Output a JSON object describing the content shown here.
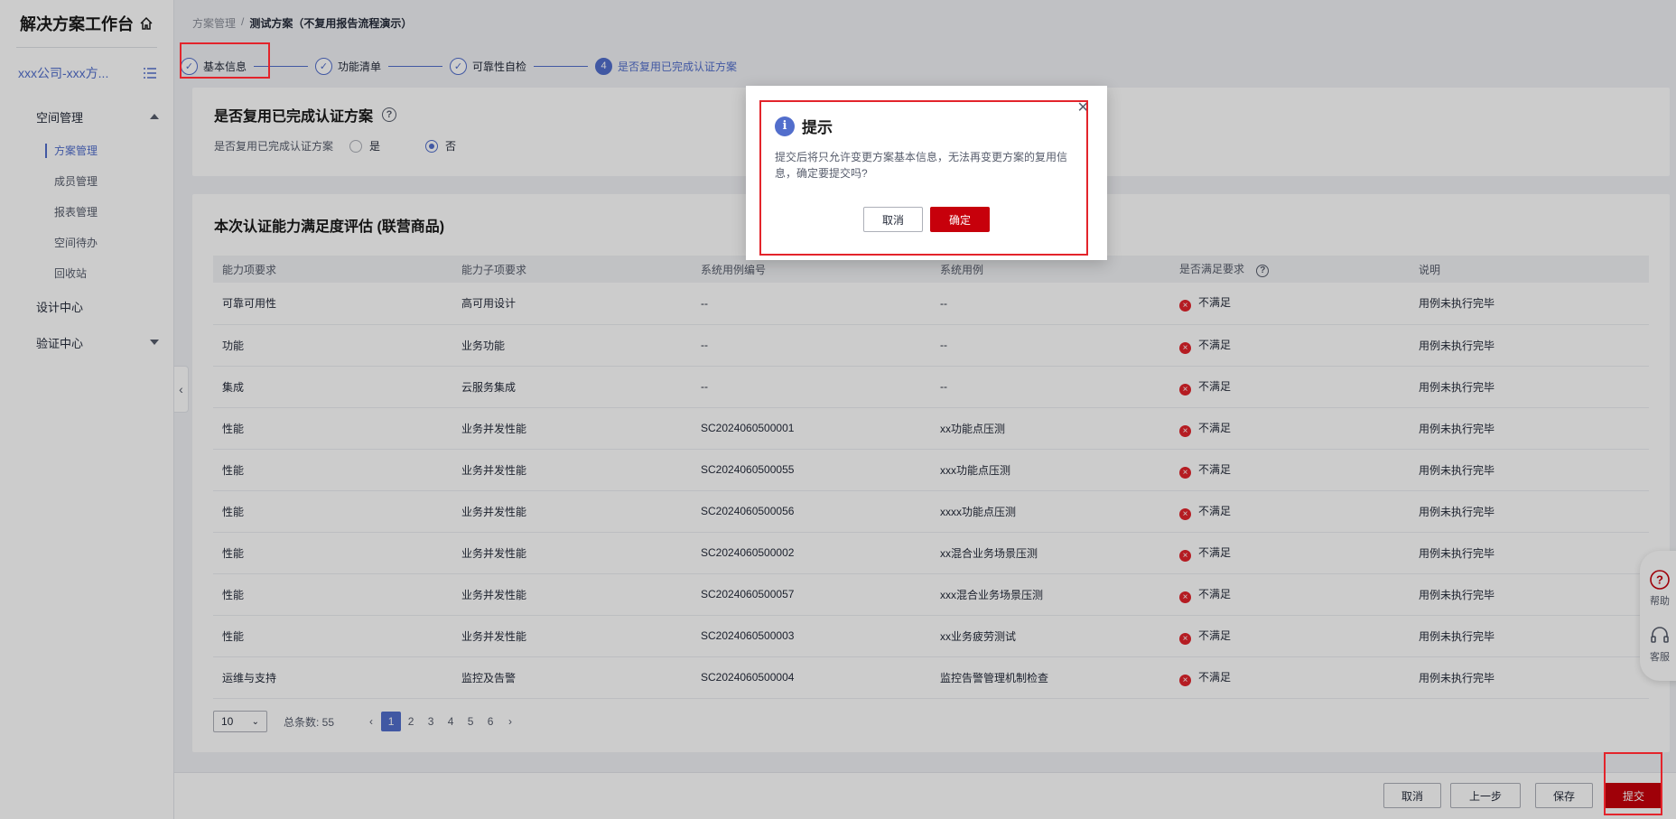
{
  "sidebar": {
    "app_title": "解决方案工作台",
    "tenant": "xxx公司-xxx方...",
    "groups": [
      {
        "label": "空间管理",
        "items": [
          "方案管理",
          "成员管理",
          "报表管理",
          "空间待办",
          "回收站"
        ]
      },
      {
        "label": "设计中心"
      },
      {
        "label": "验证中心"
      }
    ]
  },
  "breadcrumb": {
    "parent": "方案管理",
    "separator": "/",
    "current": "测试方案（不复用报告流程演示）"
  },
  "steps": [
    {
      "label": "基本信息",
      "status": "done"
    },
    {
      "label": "功能清单",
      "status": "done"
    },
    {
      "label": "可靠性自检",
      "status": "done"
    },
    {
      "label": "是否复用已完成认证方案",
      "status": "current",
      "number": "4"
    }
  ],
  "reuse_section": {
    "title": "是否复用已完成认证方案",
    "field_label": "是否复用已完成认证方案",
    "options": [
      "是",
      "否"
    ],
    "selected": "否"
  },
  "eval_section": {
    "title": "本次认证能力满足度评估 (联营商品)",
    "columns": [
      "能力项要求",
      "能力子项要求",
      "系统用例编号",
      "系统用例",
      "是否满足要求",
      "说明"
    ],
    "rows": [
      [
        "可靠可用性",
        "高可用设计",
        "--",
        "--",
        "不满足",
        "用例未执行完毕"
      ],
      [
        "功能",
        "业务功能",
        "--",
        "--",
        "不满足",
        "用例未执行完毕"
      ],
      [
        "集成",
        "云服务集成",
        "--",
        "--",
        "不满足",
        "用例未执行完毕"
      ],
      [
        "性能",
        "业务并发性能",
        "SC2024060500001",
        "xx功能点压测",
        "不满足",
        "用例未执行完毕"
      ],
      [
        "性能",
        "业务并发性能",
        "SC2024060500055",
        "xxx功能点压测",
        "不满足",
        "用例未执行完毕"
      ],
      [
        "性能",
        "业务并发性能",
        "SC2024060500056",
        "xxxx功能点压测",
        "不满足",
        "用例未执行完毕"
      ],
      [
        "性能",
        "业务并发性能",
        "SC2024060500002",
        "xx混合业务场景压测",
        "不满足",
        "用例未执行完毕"
      ],
      [
        "性能",
        "业务并发性能",
        "SC2024060500057",
        "xxx混合业务场景压测",
        "不满足",
        "用例未执行完毕"
      ],
      [
        "性能",
        "业务并发性能",
        "SC2024060500003",
        "xx业务疲劳测试",
        "不满足",
        "用例未执行完毕"
      ],
      [
        "运维与支持",
        "监控及告警",
        "SC2024060500004",
        "监控告警管理机制检查",
        "不满足",
        "用例未执行完毕"
      ]
    ]
  },
  "pagination": {
    "page_size": "10",
    "total_label": "总条数: 55",
    "pages": [
      "1",
      "2",
      "3",
      "4",
      "5",
      "6"
    ],
    "current_page": "1"
  },
  "footer": {
    "cancel": "取消",
    "prev": "上一步",
    "save": "保存",
    "submit": "提交"
  },
  "float_help": {
    "help": "帮助",
    "service": "客服"
  },
  "modal": {
    "title": "提示",
    "message": "提交后将只允许变更方案基本信息，无法再变更方案的复用信息，确定要提交吗?",
    "cancel": "取消",
    "confirm": "确定"
  },
  "colors": {
    "accent": "#526ecc",
    "danger": "#c7000b",
    "annotation": "#e3242b"
  }
}
